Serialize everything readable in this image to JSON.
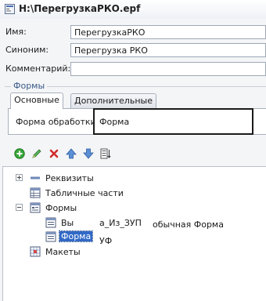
{
  "window": {
    "title": "H:\\ПерегрузкаРКО.epf"
  },
  "fields": {
    "name_label": "Имя:",
    "name_value": "ПерегрузкаРКО",
    "synonym_label": "Синоним:",
    "synonym_value": "Перегрузка РКО",
    "comment_label": "Комментарий:",
    "comment_value": ""
  },
  "forms_group": {
    "label": "Формы",
    "tabs": [
      {
        "label": "Основные"
      },
      {
        "label": "Дополнительные"
      }
    ],
    "processing_form_label": "Форма обработки:",
    "processing_form_value": "Форма"
  },
  "toolbar": {
    "icons": [
      "add-icon",
      "edit-icon",
      "delete-icon",
      "move-up-icon",
      "move-down-icon",
      "sort-icon"
    ]
  },
  "tree": {
    "items": [
      {
        "label": "Реквизиты",
        "icon": "attributes-icon"
      },
      {
        "label": "Табличные части",
        "icon": "table-icon"
      },
      {
        "label": "Формы",
        "icon": "forms-icon"
      },
      {
        "label": "Вы",
        "icon": "form-icon"
      },
      {
        "label": "Форма",
        "icon": "form-icon"
      },
      {
        "label": "Макеты",
        "icon": "templates-icon"
      }
    ],
    "overlay_texts": [
      "а_Из_ЗУП",
      "обычная Форма",
      "УФ"
    ]
  }
}
